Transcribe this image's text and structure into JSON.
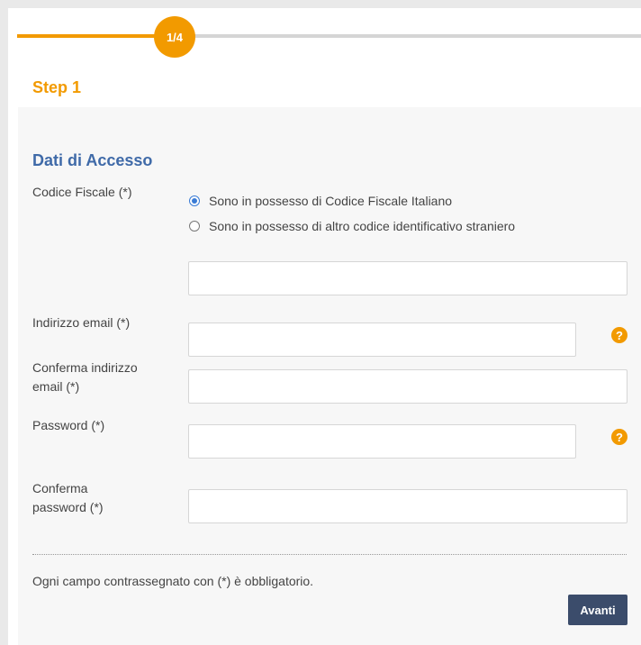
{
  "progress": {
    "badge": "1/4",
    "fraction_done": 0.25
  },
  "step_title": "Step 1",
  "section_title": "Dati di Accesso",
  "fields": {
    "codice_fiscale_label": "Codice Fiscale (*)",
    "radio_italian": "Sono in possesso di Codice Fiscale Italiano",
    "radio_foreign": "Sono in possesso di altro codice identificativo straniero",
    "codice_value": "",
    "email_label": "Indirizzo email (*)",
    "email_value": "",
    "confirm_email_label_1": "Conferma indirizzo",
    "confirm_email_label_2": "email (*)",
    "confirm_email_value": "",
    "password_label": "Password (*)",
    "password_value": "",
    "confirm_password_label_1": "Conferma",
    "confirm_password_label_2": "password (*)",
    "confirm_password_value": ""
  },
  "help_glyph": "?",
  "note": "Ogni campo contrassegnato con (*) è obbligatorio.",
  "next_button": "Avanti",
  "colors": {
    "accent": "#f29a00",
    "section": "#3f6aa8",
    "button": "#3b4c6b"
  }
}
